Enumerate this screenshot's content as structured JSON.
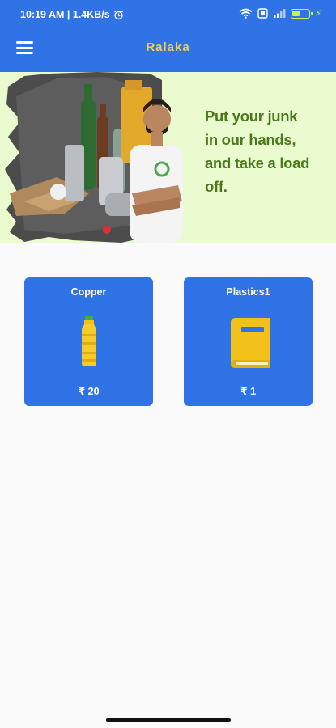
{
  "status_bar": {
    "time_speed": "10:19 AM | 1.4KB/s",
    "battery_level": "51",
    "icons": [
      "alarm-icon",
      "wifi-icon",
      "sim-icon",
      "signal-icon",
      "battery-icon",
      "charging-icon"
    ]
  },
  "app_bar": {
    "title": "Ralaka",
    "menu_icon": "hamburger-menu-icon"
  },
  "banner": {
    "line1": "Put your junk",
    "line2": "in our hands,",
    "line3": "and take a load off."
  },
  "products": [
    {
      "name": "Copper",
      "price": "₹ 20",
      "icon": "oil-bottle-icon"
    },
    {
      "name": "Plastics1",
      "price": "₹ 1",
      "icon": "book-icon"
    }
  ],
  "colors": {
    "primary": "#2f73e6",
    "title": "#f3d040",
    "banner_bg": "#eafbcf",
    "banner_text": "#4a7a1a"
  }
}
